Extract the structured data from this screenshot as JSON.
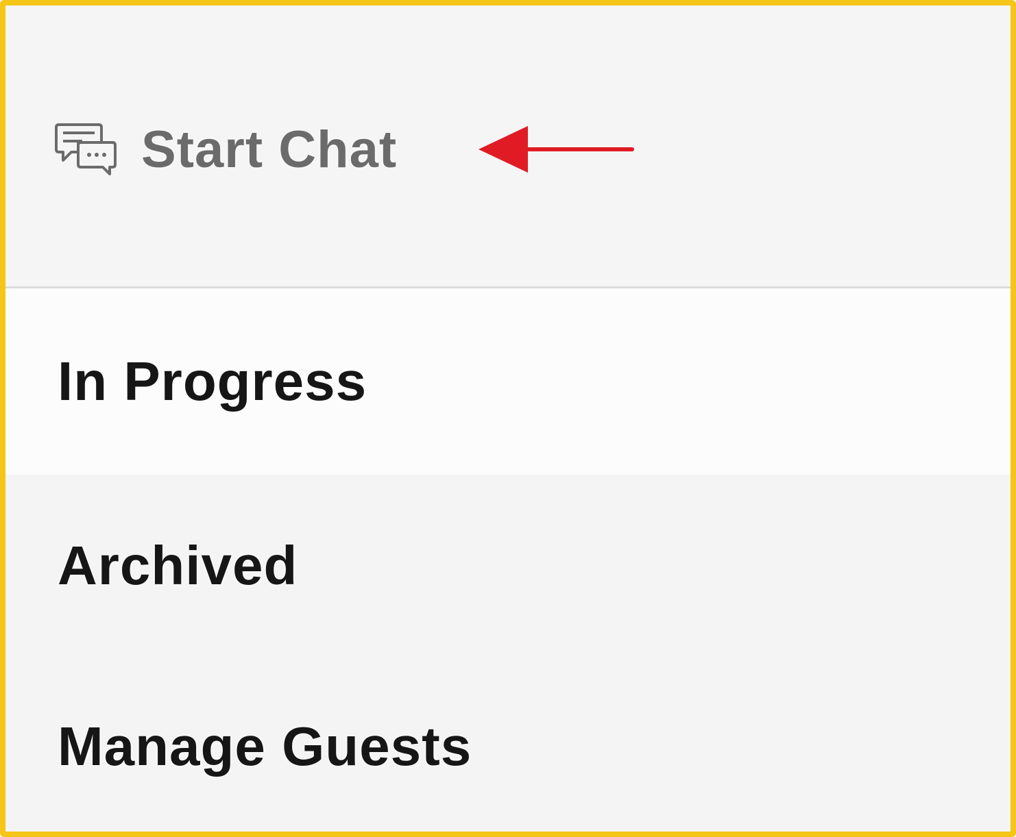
{
  "header": {
    "start_chat_label": "Start Chat",
    "start_chat_icon": "chat-bubbles-icon"
  },
  "annotation": {
    "arrow_color": "#e01b24",
    "arrow_direction": "left"
  },
  "nav": {
    "items": [
      {
        "label": "In Progress"
      },
      {
        "label": "Archived"
      },
      {
        "label": "Manage Guests"
      }
    ]
  },
  "colors": {
    "frame_border": "#f5c518",
    "panel_background": "#f5f5f5",
    "active_item_background": "#fcfcfc",
    "start_chat_text": "#6b6b6b",
    "nav_text": "#161616"
  }
}
